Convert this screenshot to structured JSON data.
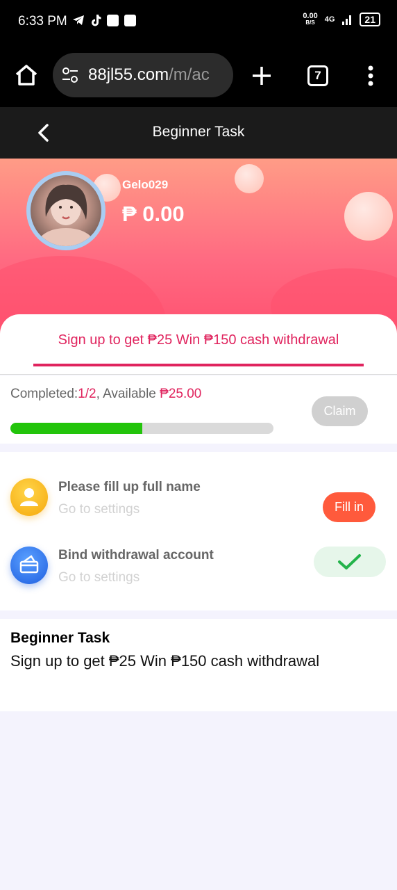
{
  "status_bar": {
    "time": "6:33 PM",
    "speed_value": "0.00",
    "speed_unit": "B/S",
    "network": "4G",
    "battery": "21"
  },
  "browser": {
    "url_main": "88jl55.com",
    "url_rest": "/m/ac",
    "tab_count": "7"
  },
  "header": {
    "title": "Beginner Task"
  },
  "profile": {
    "username": "Gelo029",
    "balance": "₱ 0.00"
  },
  "tab": {
    "label": "Sign up to get ₱25  Win ₱150 cash withdrawal"
  },
  "progress": {
    "completed_label": "Completed:",
    "completed_value": "1/2",
    "available_label": ", Available ",
    "available_value": "₱25.00",
    "fraction": 0.5,
    "claim_label": "Claim"
  },
  "tasks": [
    {
      "title": "Please fill up full name",
      "subtitle": "Go to settings",
      "action_label": "Fill in",
      "icon": "user-icon",
      "done": false
    },
    {
      "title": "Bind withdrawal account",
      "subtitle": "Go to settings",
      "icon": "card-icon",
      "done": true
    }
  ],
  "description": {
    "title": "Beginner Task",
    "text": "Sign up to get ₱25 Win ₱150 cash withdrawal"
  },
  "colors": {
    "accent": "#e0245e",
    "progress_fill": "#23c40b",
    "fill_button": "#ff5a3c",
    "done_check": "#23b34a"
  }
}
